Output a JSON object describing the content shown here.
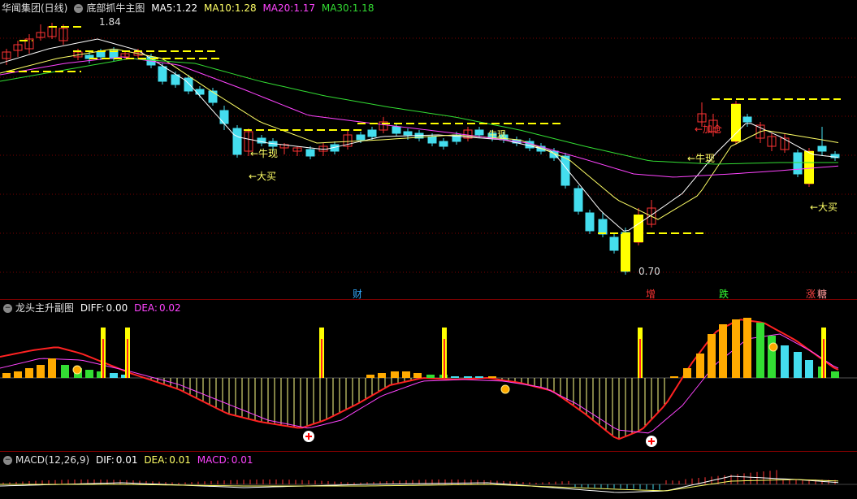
{
  "main_panel": {
    "stock_name": "华闻集团(日线)",
    "indicator_name": "底部抓牛主图",
    "ma": [
      {
        "label": "MA5:",
        "value": "1.22",
        "color": "#ffffff"
      },
      {
        "label": "MA10:",
        "value": "1.28",
        "color": "#ffff66"
      },
      {
        "label": "MA20:",
        "value": "1.17",
        "color": "#ff44ff"
      },
      {
        "label": "MA30:",
        "value": "1.18",
        "color": "#33dd33"
      }
    ],
    "price_high": "1.84",
    "price_low": "0.70",
    "signals": {
      "niuxian1": "←牛现",
      "dami1": "←大买",
      "niuxian_mid": "牛现",
      "jiacang": "←加仓",
      "niuxian2": "←牛现",
      "dami2": "←大买"
    },
    "events": [
      {
        "label": "财",
        "color": "#33aaff"
      },
      {
        "label": "增",
        "color": "#ff3333"
      },
      {
        "label": "跌",
        "color": "#33ff33"
      },
      {
        "label": "涨",
        "color": "#ff4444"
      },
      {
        "label": "糖",
        "color": "#ff9999"
      }
    ]
  },
  "sub_panel1": {
    "name": "龙头主升副图",
    "diff_label": "DIFF:",
    "diff_value": "0.00",
    "dea_label": "DEA:",
    "dea_value": "0.02"
  },
  "sub_panel2": {
    "name": "MACD(12,26,9)",
    "dif_label": "DIF:",
    "dif_value": "0.01",
    "dea_label": "DEA:",
    "dea_value": "0.01",
    "macd_label": "MACD:",
    "macd_value": "0.01"
  },
  "colors": {
    "up": "#ff3333",
    "down": "#44ddee",
    "grid": "#7a0000",
    "signal_yellow": "#ffff00"
  }
}
